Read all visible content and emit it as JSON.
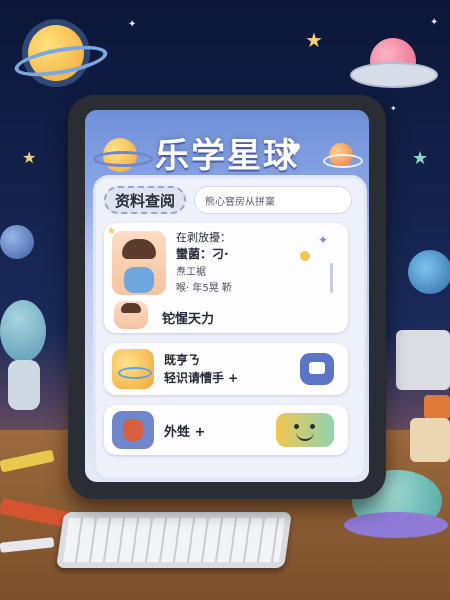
{
  "app": {
    "title": "乐学星球"
  },
  "header": {
    "heart_icon": "heart-icon"
  },
  "search_bar": {
    "tab_label": "资料查阅",
    "placeholder": "熊心窨房从拼稟"
  },
  "profile_card": {
    "title": "在剥放擾：",
    "line1": "蠻菌：刁·",
    "line2": "焘工裾",
    "line3": "喉· 年5晃  鞒",
    "subtitle": "铊惺天力"
  },
  "card2": {
    "line1": "既亨ㄋ",
    "line2": "轻识请慒手  +"
  },
  "card3": {
    "line1": "外甡 +"
  },
  "colors": {
    "header_blue": "#6f8fd6",
    "panel": "#eef1fa",
    "card": "#fdfdff",
    "accent_blue": "#5b74c7",
    "accent_yellow": "#f2c64f"
  }
}
